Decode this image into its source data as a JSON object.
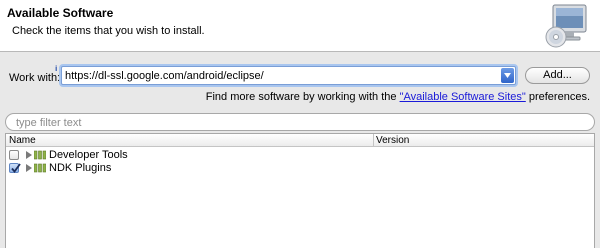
{
  "header": {
    "title": "Available Software",
    "description": "Check the items that you wish to install.",
    "image": "monitor-with-cd-icon"
  },
  "work_with": {
    "label": "Work with:",
    "value": "https://dl-ssl.google.com/android/eclipse/",
    "add_button": "Add..."
  },
  "find_more": {
    "prefix": "Find more software by working with the ",
    "link": "\"Available Software Sites\"",
    "suffix": " preferences."
  },
  "filter": {
    "placeholder": "type filter text"
  },
  "tree": {
    "columns": [
      "Name",
      "Version"
    ],
    "items": [
      {
        "label": "Developer Tools",
        "checked": false,
        "icon": "package-group-icon"
      },
      {
        "label": "NDK Plugins",
        "checked": true,
        "icon": "package-group-icon"
      }
    ]
  },
  "colors": {
    "link": "#1a1ad8",
    "focus_ring": "#a9c6ef",
    "dropdown_button": "#2f64c9"
  }
}
